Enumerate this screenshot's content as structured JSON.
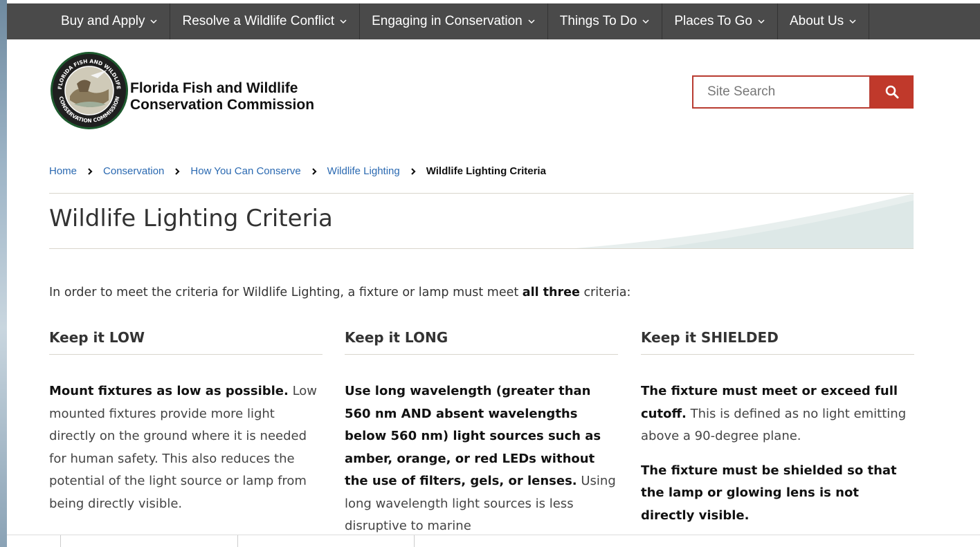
{
  "nav": {
    "items": [
      {
        "label": "Buy and Apply"
      },
      {
        "label": "Resolve a Wildlife Conflict"
      },
      {
        "label": "Engaging in Conservation"
      },
      {
        "label": "Things To Do"
      },
      {
        "label": "Places To Go"
      },
      {
        "label": "About Us"
      }
    ]
  },
  "header": {
    "org_line1": "Florida Fish and Wildlife",
    "org_line2": "Conservation Commission",
    "logo_text_top": "FLORIDA FISH AND WILDLIFE",
    "logo_text_bottom": "CONSERVATION COMMISSION"
  },
  "search": {
    "placeholder": "Site Search"
  },
  "breadcrumb": {
    "items": [
      "Home",
      "Conservation",
      "How You Can Conserve",
      "Wildlife Lighting"
    ],
    "current": "Wildlife Lighting Criteria"
  },
  "page": {
    "title": "Wildlife Lighting Criteria",
    "intro_pre": "In order to meet the criteria for Wildlife Lighting, a fixture or lamp must meet ",
    "intro_bold": "all three",
    "intro_post": " criteria:"
  },
  "columns": [
    {
      "heading": "Keep it LOW",
      "bold": "Mount fixtures as low as possible.",
      "text": " Low mounted fixtures provide more light directly on the ground where it is needed for human safety.  This also reduces the potential of the light source or lamp from being directly visible."
    },
    {
      "heading": "Keep it LONG",
      "bold": "Use long wavelength (greater than 560 nm AND absent wavelengths below 560 nm) light sources such as amber, orange, or red LEDs without the use of filters, gels, or lenses.",
      "text": "  Using long wavelength light sources is less disruptive to marine"
    },
    {
      "heading": "Keep it SHIELDED",
      "bold": "The fixture must meet or exceed full cutoff.",
      "text": "  This is defined as no light emitting above a 90-degree plane.",
      "bold2": "The fixture must be shielded so that the lamp or glowing lens is not directly visible."
    }
  ],
  "colors": {
    "nav_bg": "#4a4a4a",
    "accent": "#c0392b",
    "link": "#2a69b1"
  }
}
